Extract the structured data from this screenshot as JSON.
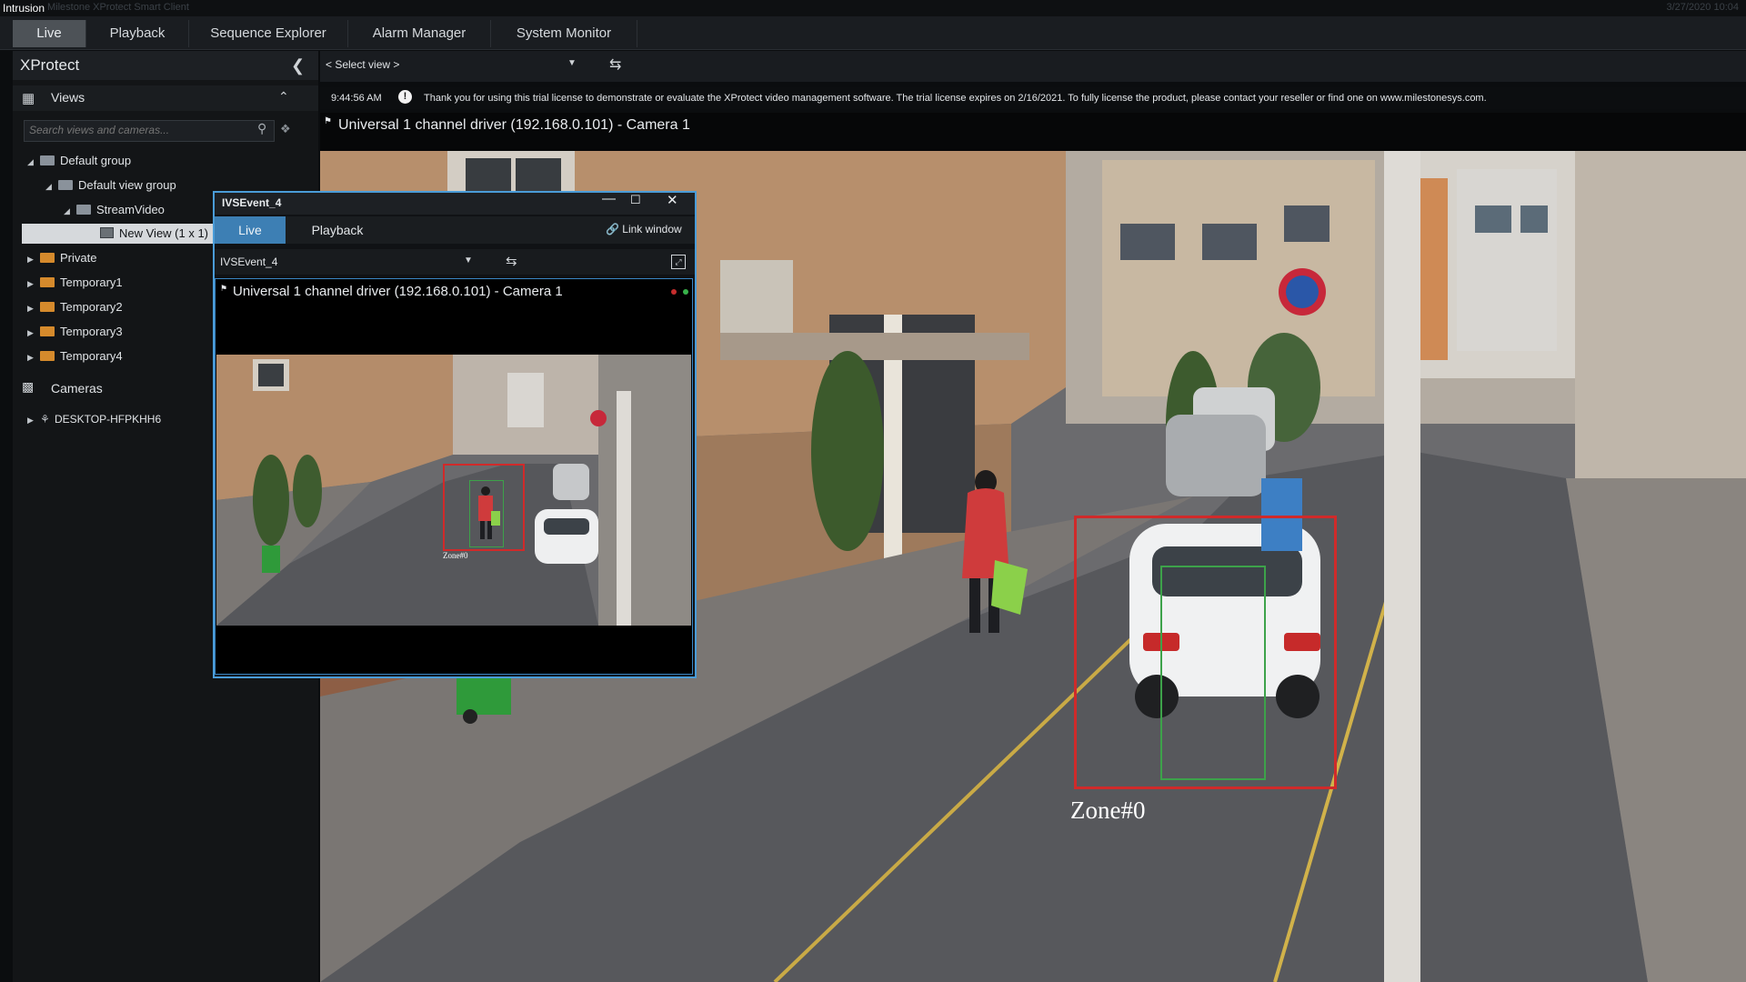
{
  "window": {
    "caption": "Intrusion",
    "app_title": "Milestone XProtect Smart Client",
    "datetime": "3/27/2020 10:04"
  },
  "tabs": [
    {
      "label": "Live",
      "active": true
    },
    {
      "label": "Playback",
      "active": false
    },
    {
      "label": "Sequence Explorer",
      "active": false
    },
    {
      "label": "Alarm Manager",
      "active": false
    },
    {
      "label": "System Monitor",
      "active": false
    }
  ],
  "sidebar": {
    "title": "XProtect",
    "views_label": "Views",
    "search_placeholder": "Search views and cameras...",
    "tree": [
      {
        "label": "Default group"
      },
      {
        "label": "Default view group"
      },
      {
        "label": "StreamVideo"
      },
      {
        "label": "New View (1 x 1)",
        "selected": true
      },
      {
        "label": "Private"
      },
      {
        "label": "Temporary1"
      },
      {
        "label": "Temporary2"
      },
      {
        "label": "Temporary3"
      },
      {
        "label": "Temporary4"
      }
    ],
    "cameras_label": "Cameras",
    "camera_server": "DESKTOP-HFPKHH6"
  },
  "toolbar": {
    "select_view": "< Select view >"
  },
  "license": {
    "time": "9:44:56 AM",
    "message": "Thank you for using this trial license to demonstrate or evaluate the XProtect video management software. The trial license expires on 2/16/2021. To fully license the product, please contact your reseller or find one on www.milestonesys.com."
  },
  "main_camera": {
    "title": "Universal 1 channel driver (192.168.0.101) - Camera 1",
    "zone_label": "Zone#0"
  },
  "popup": {
    "title": "IVSEvent_4",
    "tab_live": "Live",
    "tab_playback": "Playback",
    "link_window": "Link window",
    "view_select": "IVSEvent_4",
    "camera_title": "Universal 1 channel driver (192.168.0.101) - Camera 1",
    "zone_label": "Zone#0"
  },
  "colors": {
    "accent_blue": "#3d7fb4",
    "popup_border": "#4a9cd8",
    "detection_red": "#d02a2a",
    "detection_green": "#3da24a"
  },
  "icons": [
    "views-grid-icon",
    "chevron-left-icon",
    "chevron-up-icon",
    "search-icon",
    "filter-icon",
    "folder-icon",
    "camera-icon",
    "server-icon",
    "sync-icon",
    "info-icon",
    "link-icon",
    "fullscreen-icon",
    "minimize-icon",
    "maximize-icon",
    "close-icon"
  ]
}
